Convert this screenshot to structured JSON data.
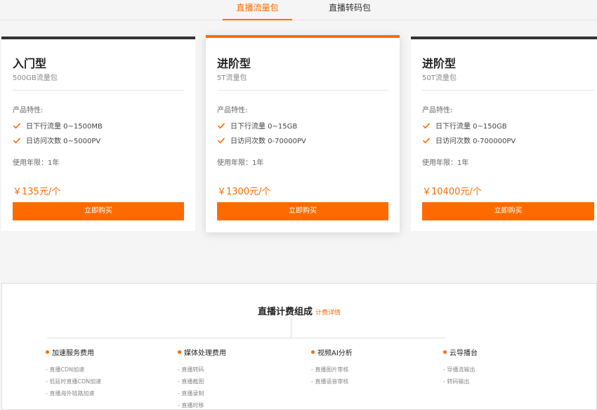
{
  "tabs": [
    {
      "label": "直播流量包",
      "active": true
    },
    {
      "label": "直播转码包",
      "active": false
    }
  ],
  "cards": [
    {
      "title": "入门型",
      "subtitle": "500GB流量包",
      "features_label": "产品特性:",
      "features": [
        "日下行流量 0~1500MB",
        "日访问次数 0~5000PV"
      ],
      "term": "使用年限：1年",
      "price": "￥135元/个",
      "buy_label": "立即购买"
    },
    {
      "title": "进阶型",
      "subtitle": "5T流量包",
      "features_label": "产品特性:",
      "features": [
        "日下行流量 0~15GB",
        "日访问次数 0-70000PV"
      ],
      "term": "使用年限：1年",
      "price": "￥1300元/个",
      "buy_label": "立即购买",
      "featured": true
    },
    {
      "title": "进阶型",
      "subtitle": "50T流量包",
      "features_label": "产品特性:",
      "features": [
        "日下行流量 0~150GB",
        "日访问次数 0-700000PV"
      ],
      "term": "使用年限：1年",
      "price": "￥10400元/个",
      "buy_label": "立即购买"
    }
  ],
  "billing": {
    "title": "直播计费组成",
    "link": "计费详情",
    "columns": [
      {
        "title": "加速服务费用",
        "items": [
          "- 直播CDN加速",
          "- 低延时直播CDN加速",
          "- 直播海外链路加速"
        ]
      },
      {
        "title": "媒体处理费用",
        "items": [
          "- 直播转码",
          "- 直播截图",
          "- 直播录制",
          "- 直播时移"
        ]
      },
      {
        "title": "视频AI分析",
        "items": [
          "- 直播图片审核",
          "- 直播语音审核"
        ]
      },
      {
        "title": "云导播台",
        "items": [
          "- 导播流输出",
          "- 转码输出"
        ]
      }
    ]
  },
  "colors": {
    "accent": "#ff6a00",
    "dark_top": "#333333"
  },
  "icons": {
    "check": "check-icon",
    "bullet": "dot-icon"
  }
}
